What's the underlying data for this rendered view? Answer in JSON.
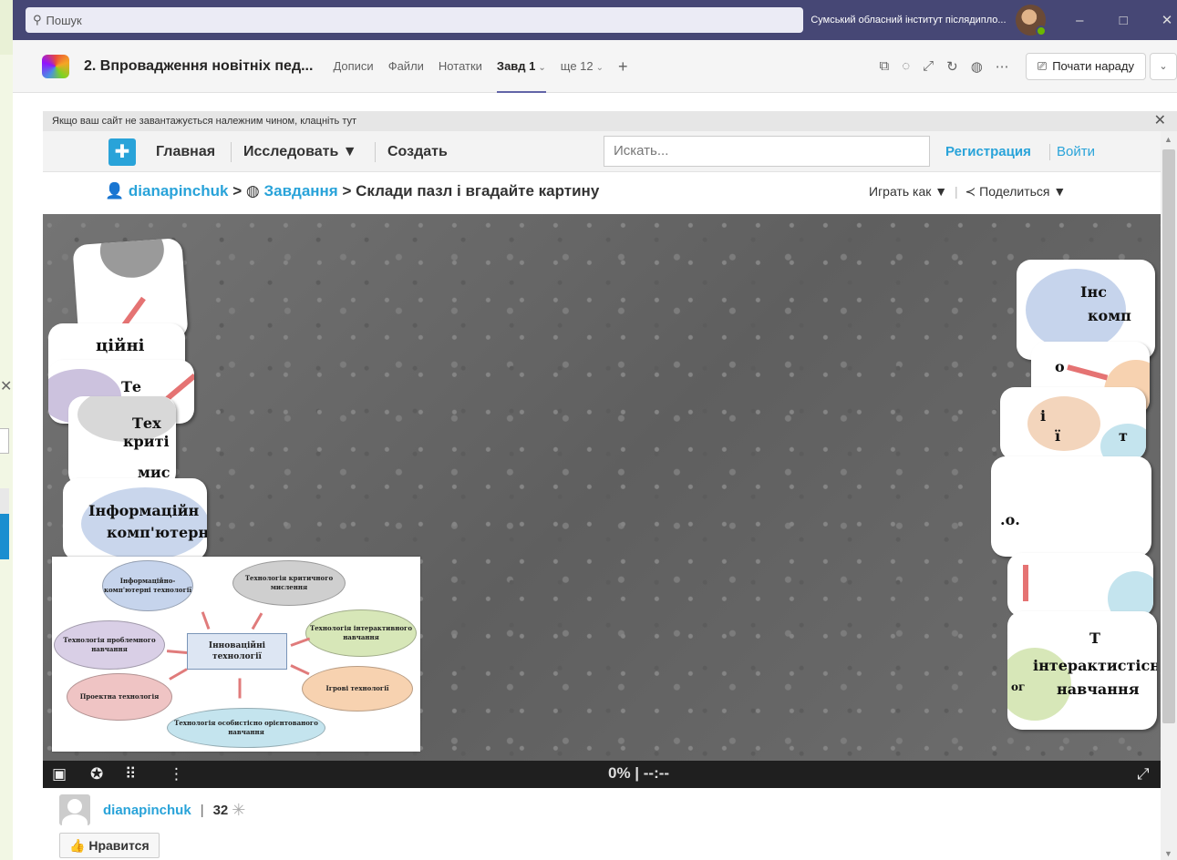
{
  "teams": {
    "search_placeholder": "Пошук",
    "org_name": "Сумський обласний інститут післядипло...",
    "window_controls": {
      "minimize": "–",
      "maximize": "□",
      "close": "✕"
    }
  },
  "channel": {
    "title": "2. Впровадження новітніх пед...",
    "tabs": [
      {
        "label": "Дописи"
      },
      {
        "label": "Файли"
      },
      {
        "label": "Нотатки"
      },
      {
        "label": "Завд 1",
        "active": true
      },
      {
        "label": "ще 12"
      }
    ],
    "add_tab": "+",
    "more_icon": "⋯",
    "meet_label": "Почати нараду"
  },
  "notice": {
    "text": "Якщо ваш сайт не завантажується належним чином, клацніть тут",
    "close": "✕"
  },
  "site": {
    "nav": {
      "home": "Главная",
      "explore": "Исследовать ▼",
      "create": "Создать",
      "search_placeholder": "Искать...",
      "register": "Регистрация",
      "login": "Войти"
    },
    "breadcrumb": {
      "user": "dianapinchuk",
      "sep1": ">",
      "folder": "Завдання",
      "sep2": ">",
      "title": "Склади пазл і вгадайте картину"
    },
    "play_as": "Играть как ▼",
    "share": "Поделиться ▼",
    "progress_text": "0% | --:--",
    "progress_fraction": 0,
    "author": "dianapinchuk",
    "separator": "|",
    "count": "32",
    "like": "Нравится"
  },
  "pieces_text": {
    "l1": "ційні",
    "l2": "Те",
    "l3": "Тех",
    "l4": "криті",
    "l5": "мис",
    "l6": "Інформаційн",
    "l7": "комп'ютерні",
    "r1": "Інс",
    "r2": "комп",
    "r3": "о",
    "r4": "і",
    "r5": "ї",
    "r6": "т",
    "r7": ".о.",
    "r8": "Т",
    "r9": "інтерактистісн",
    "r10": "навчання",
    "r11": "ог"
  },
  "reference_image": {
    "center": "Інноваційні\nтехнології",
    "nodes": [
      {
        "text": "Інформаційно-комп'ютерні технології",
        "color": "#c6d4ec"
      },
      {
        "text": "Технологія критичного мислення",
        "color": "#cfcfcf"
      },
      {
        "text": "Технологія інтерактивного навчання",
        "color": "#d7e7b8"
      },
      {
        "text": "Ігрові технології",
        "color": "#f7d2b0"
      },
      {
        "text": "Технологія особистісно орієнтованого навчання",
        "color": "#c4e4ee"
      },
      {
        "text": "Проектна технологія",
        "color": "#efc4c4"
      },
      {
        "text": "Технологія проблемного навчання",
        "color": "#d9cfe6"
      }
    ]
  }
}
